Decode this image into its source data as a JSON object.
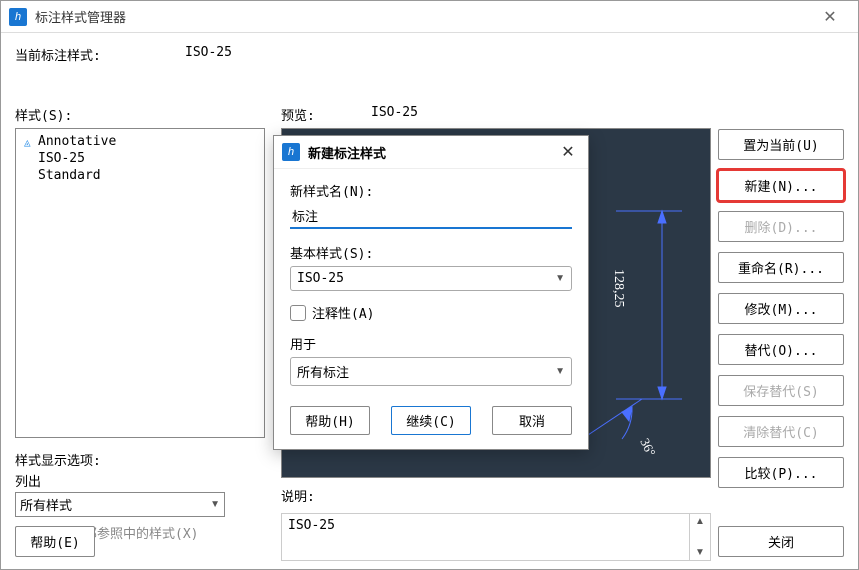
{
  "window": {
    "title": "标注样式管理器"
  },
  "current": {
    "label": "当前标注样式:",
    "value": "ISO-25"
  },
  "styles": {
    "label": "样式(S):",
    "items": [
      "Annotative",
      "ISO-25",
      "Standard"
    ]
  },
  "displayOptions": {
    "label": "样式显示选项:",
    "listLabel": "列出",
    "listValue": "所有样式",
    "excludeXrefLabel": "不列出外部参照中的样式(X)"
  },
  "preview": {
    "label": "预览:",
    "styleName": "ISO-25",
    "dimText": "128,25",
    "angleText": "36°"
  },
  "description": {
    "label": "说明:",
    "text": "ISO-25"
  },
  "buttons": {
    "setCurrent": "置为当前(U)",
    "new": "新建(N)...",
    "delete": "删除(D)...",
    "rename": "重命名(R)...",
    "modify": "修改(M)...",
    "override": "替代(O)...",
    "saveOverride": "保存替代(S)",
    "clearOverride": "清除替代(C)",
    "compare": "比较(P)...",
    "helpBottom": "帮助(E)",
    "close": "关闭"
  },
  "dialog": {
    "title": "新建标注样式",
    "newNameLabel": "新样式名(N):",
    "newNameValue": "标注",
    "baseStyleLabel": "基本样式(S):",
    "baseStyleValue": "ISO-25",
    "annotativeLabel": "注释性(A)",
    "useForLabel": "用于",
    "useForValue": "所有标注",
    "help": "帮助(H)",
    "continue": "继续(C)",
    "cancel": "取消"
  }
}
